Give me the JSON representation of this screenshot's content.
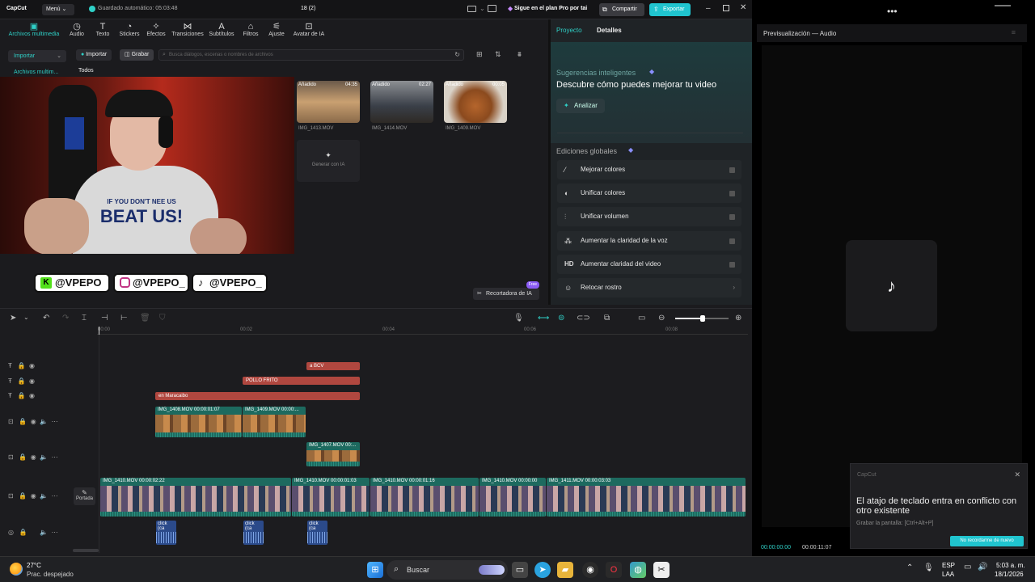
{
  "titlebar": {
    "app_name": "CapCut",
    "menu_label": "Menú",
    "autosave": "Guardado automático: 05:03:48",
    "project_title": "18 (2)",
    "pro_promo": "Sigue en el plan Pro por tai",
    "share_label": "Compartir",
    "export_label": "Exportar"
  },
  "toolbar": {
    "items": [
      {
        "label": "Archivos multimedia",
        "icon": "media-icon"
      },
      {
        "label": "Audio",
        "icon": "audio-icon"
      },
      {
        "label": "Texto",
        "icon": "text-icon"
      },
      {
        "label": "Stickers",
        "icon": "sticker-icon"
      },
      {
        "label": "Efectos",
        "icon": "effects-icon"
      },
      {
        "label": "Transiciones",
        "icon": "transitions-icon"
      },
      {
        "label": "Subtítulos",
        "icon": "subtitles-icon"
      },
      {
        "label": "Filtros",
        "icon": "filters-icon"
      },
      {
        "label": "Ajuste",
        "icon": "adjust-icon"
      },
      {
        "label": "Avatar de IA",
        "icon": "ai-avatar-icon"
      }
    ]
  },
  "media": {
    "import_dropdown": "Importar",
    "import_button": "Importar",
    "record_button": "Grabar",
    "search_placeholder": "Busca diálogos, escenas o nombres de archivos",
    "sidebar_item": "Archivos multim...",
    "filter_all": "Todos",
    "items": [
      {
        "tag": "Añadido",
        "duration": "04:35",
        "name": "IMG_1413.MOV"
      },
      {
        "tag": "Añadido",
        "duration": "02:27",
        "name": "IMG_1414.MOV"
      },
      {
        "tag": "Añadido",
        "duration": "00:05",
        "name": "IMG_1409.MOV"
      }
    ],
    "generate_label": "Generar con IA",
    "ai_recorder": "Recortadora de IA",
    "free_badge": "Free"
  },
  "webcam": {
    "shirt_text_1": "IF YOU DON'T NEE US",
    "shirt_text_2": "BEAT US!",
    "socials": [
      {
        "platform": "kick",
        "handle": "@VPEPO"
      },
      {
        "platform": "instagram",
        "handle": "@VPEPO_"
      },
      {
        "platform": "tiktok",
        "handle": "@VPEPO_"
      }
    ]
  },
  "right_panel": {
    "tab_project": "Proyecto",
    "tab_details": "Detalles",
    "smart_title": "Sugerencias inteligentes",
    "smart_heading": "Descubre cómo puedes mejorar tu video",
    "analyze_button": "Analizar",
    "global_title": "Ediciones globales",
    "edits": [
      {
        "label": "Mejorar colores",
        "icon": "magic-wand-icon"
      },
      {
        "label": "Unificar colores",
        "icon": "palette-icon"
      },
      {
        "label": "Unificar volumen",
        "icon": "sliders-icon"
      },
      {
        "label": "Aumentar la claridad de la voz",
        "icon": "voice-icon"
      },
      {
        "label": "Aumentar claridad del video",
        "icon": "hd-icon"
      },
      {
        "label": "Retocar rostro",
        "icon": "face-icon"
      }
    ]
  },
  "timeline": {
    "ruler": [
      "00:00",
      "00:02",
      "00:04",
      "00:06",
      "00:08"
    ],
    "text_clips": [
      "a BCV",
      "POLLO FRITO",
      "en Maracaibo"
    ],
    "video_clips_top": [
      "IMG_1408.MOV  00:00:01:07",
      "IMG_1409.MOV  00:00:..."
    ],
    "video_clip_mid": "IMG_1407.MOV  00:...",
    "main_clips": [
      "IMG_1410.MOV  00:00:02:22",
      "IMG_1410.MOV  00:00:01:03",
      "IMG_1410.MOV  00:00:01:16",
      "IMG_1410.MOV  00:00:00",
      "IMG_1411.MOV  00:00:03:03"
    ],
    "cover_label": "Portada",
    "audio_clips": [
      "click (ca",
      "click (ca",
      "click (ca"
    ]
  },
  "preview": {
    "title": "Previsualización — Audio",
    "time_current": "00:00:00:00",
    "time_total": "00:00:11:07",
    "notice_app": "CapCut",
    "notice_title": "El atajo de teclado entra en conflicto con otro existente",
    "notice_sub": "Grabar la pantalla: [Ctrl+Alt+P]",
    "notice_button": "No recordarme de nuevo"
  },
  "taskbar": {
    "temperature": "27°C",
    "weather": "Prac. despejado",
    "search_label": "Buscar",
    "lang_1": "ESP",
    "lang_2": "LAA",
    "time": "5:03 a. m.",
    "date": "18/1/2026"
  },
  "colors": {
    "accent": "#2fd0c7",
    "export": "#20c4cf",
    "text_clip": "#b0473f",
    "video_clip": "#1d6a5f",
    "audio_clip": "#2b4a8a"
  }
}
